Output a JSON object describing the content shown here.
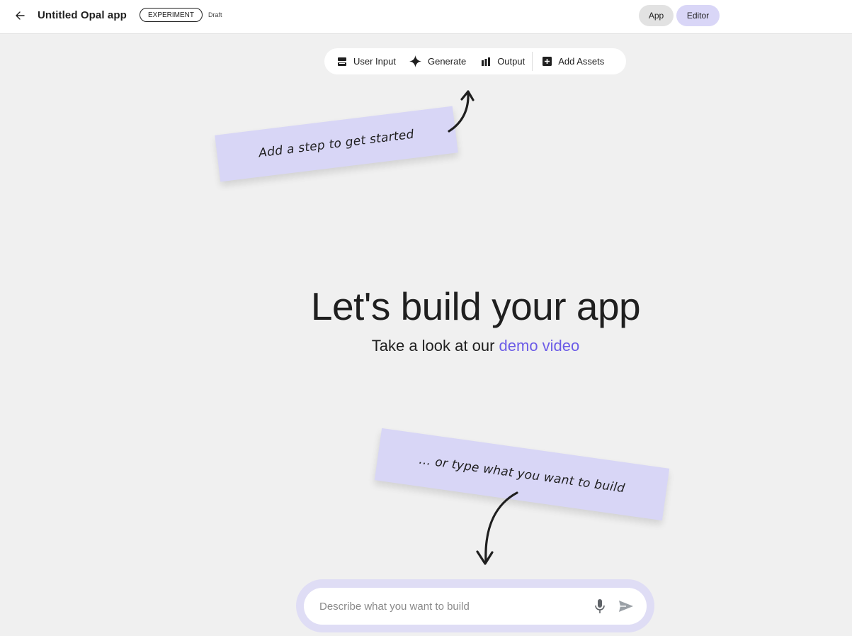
{
  "header": {
    "back_icon": "arrow-left-icon",
    "title": "Untitled Opal app",
    "badge": "EXPERIMENT",
    "status": "Draft",
    "modes": {
      "app_label": "App",
      "editor_label": "Editor",
      "active": "Editor"
    }
  },
  "toolbar": {
    "items": [
      {
        "label": "User Input",
        "icon": "user-input-icon"
      },
      {
        "label": "Generate",
        "icon": "sparkle-icon"
      },
      {
        "label": "Output",
        "icon": "output-icon"
      },
      {
        "label": "Add Assets",
        "icon": "add-box-icon"
      }
    ]
  },
  "notes": {
    "top": "Add a step to get started",
    "bottom": "... or type what you want to build"
  },
  "hero": {
    "title": "Let's build your app",
    "subtitle_prefix": "Take a look at our ",
    "link": "demo video"
  },
  "prompt": {
    "placeholder": "Describe what you want to build",
    "value": "",
    "mic_icon": "mic-icon",
    "send_icon": "send-icon"
  },
  "colors": {
    "background": "#f0f0f0",
    "note": "#d8d6f6",
    "accent_link": "#6c5ce7",
    "editor_active": "#d9d6f7",
    "prompt_ring": "#dfddf5"
  }
}
